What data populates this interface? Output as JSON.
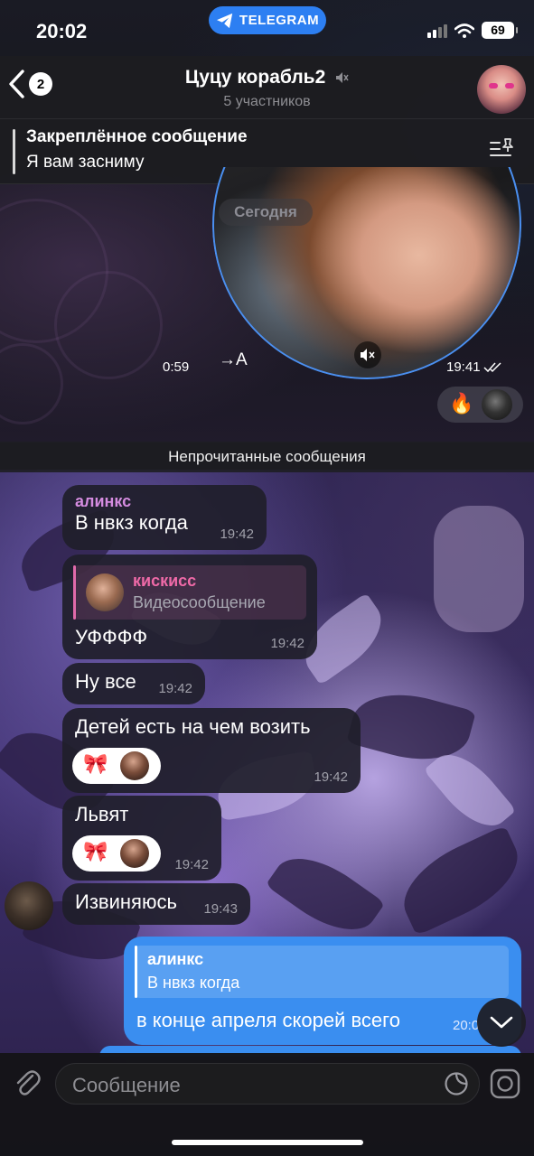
{
  "status_bar": {
    "time": "20:02",
    "app_pill": "TELEGRAM",
    "battery": "69"
  },
  "header": {
    "back_count": "2",
    "title": "Цуцу корабль2",
    "subtitle": "5 участников"
  },
  "pinned": {
    "title": "Закреплённое сообщение",
    "text": "Я вам засниму"
  },
  "video_message": {
    "date_label": "Сегодня",
    "duration": "0:59",
    "transcribe": "→A",
    "time": "19:41",
    "reactions": [
      "🔥"
    ]
  },
  "unread_label": "Непрочитанные сообщения",
  "messages": [
    {
      "sender": "алинкс",
      "text": "В нвкз когда",
      "time": "19:42"
    },
    {
      "reply_name": "кискисс",
      "reply_text": "Видеосообщение",
      "text": "УФФФФ",
      "time": "19:42"
    },
    {
      "text": "Ну все",
      "time": "19:42"
    },
    {
      "text": "Детей есть на чем возить",
      "time": "19:42",
      "reaction": "🎀"
    },
    {
      "text": "Львят",
      "time": "19:42",
      "reaction": "🎀"
    },
    {
      "text": "Извиняюсь",
      "time": "19:43"
    }
  ],
  "outgoing": {
    "reply_name": "алинкс",
    "reply_text": "В нвкз когда",
    "text": "в конце апреля скорей всего",
    "time": "20:0"
  },
  "input": {
    "placeholder": "Сообщение"
  },
  "colors": {
    "accent": "#3a8ef0",
    "sender": "#d58ce0",
    "reply_name": "#f06aa8"
  }
}
